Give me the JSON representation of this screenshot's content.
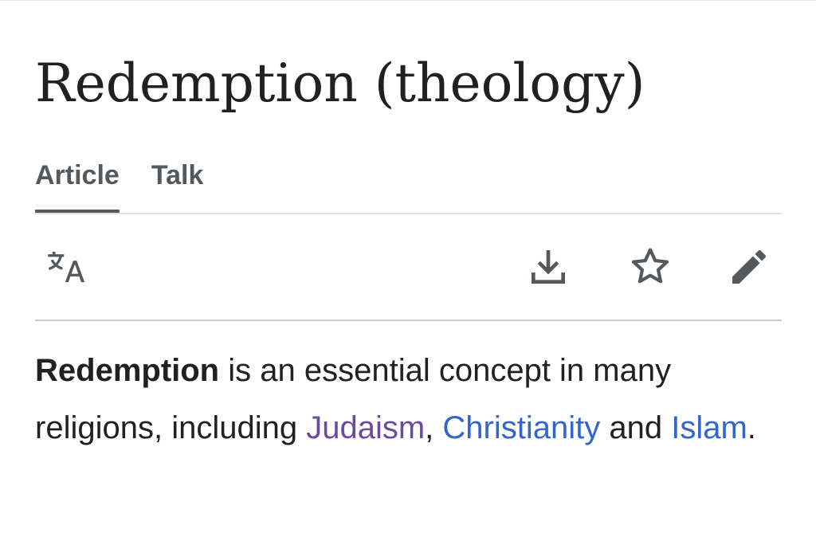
{
  "article": {
    "title": "Redemption (theology)"
  },
  "tabs": [
    {
      "label": "Article",
      "active": true
    },
    {
      "label": "Talk",
      "active": false
    }
  ],
  "toolbar": {
    "icons": [
      "language-icon",
      "download-icon",
      "star-icon",
      "edit-pencil-icon"
    ]
  },
  "content": {
    "lead_bold": "Redemption",
    "text_1": " is an essential concept in many religions, including ",
    "link_judaism": "Judaism",
    "text_2": ", ",
    "link_christianity": "Christianity",
    "text_3": " and ",
    "link_islam": "Islam",
    "text_4": "."
  },
  "colors": {
    "text": "#202122",
    "tab_text": "#54595d",
    "link": "#3366cc",
    "visited_link": "#6b4ba1",
    "icon": "#54595d"
  }
}
